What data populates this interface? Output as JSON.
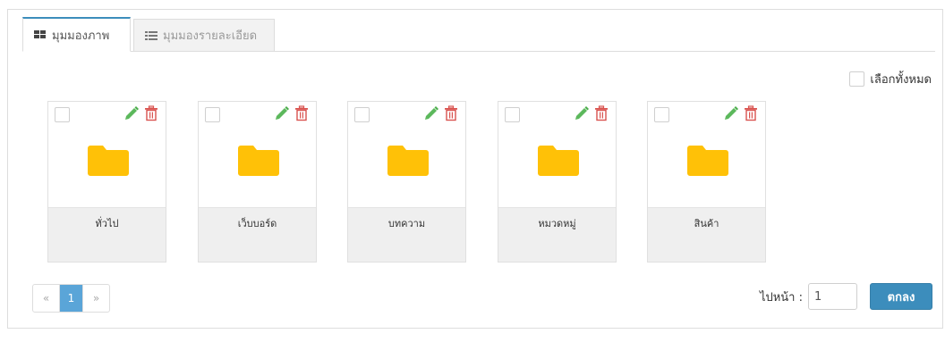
{
  "tabs": [
    {
      "label": "มุมมองภาพ",
      "icon": "grid-icon",
      "active": true
    },
    {
      "label": "มุมมองรายละเอียด",
      "icon": "list-icon",
      "active": false
    }
  ],
  "select_all_label": "เลือกทั้งหมด",
  "folders": [
    {
      "label": "ทั่วไป"
    },
    {
      "label": "เว็บบอร์ด"
    },
    {
      "label": "บทความ"
    },
    {
      "label": "หมวดหมู่"
    },
    {
      "label": "สินค้า"
    }
  ],
  "pagination": {
    "prev": "«",
    "current": "1",
    "next": "»"
  },
  "goto": {
    "label": "ไปหน้า :",
    "value": "1",
    "button": "ตกลง"
  },
  "colors": {
    "accent": "#3c8dbc",
    "folder": "#ffc107",
    "edit": "#5cb85c",
    "delete": "#d9534f"
  }
}
